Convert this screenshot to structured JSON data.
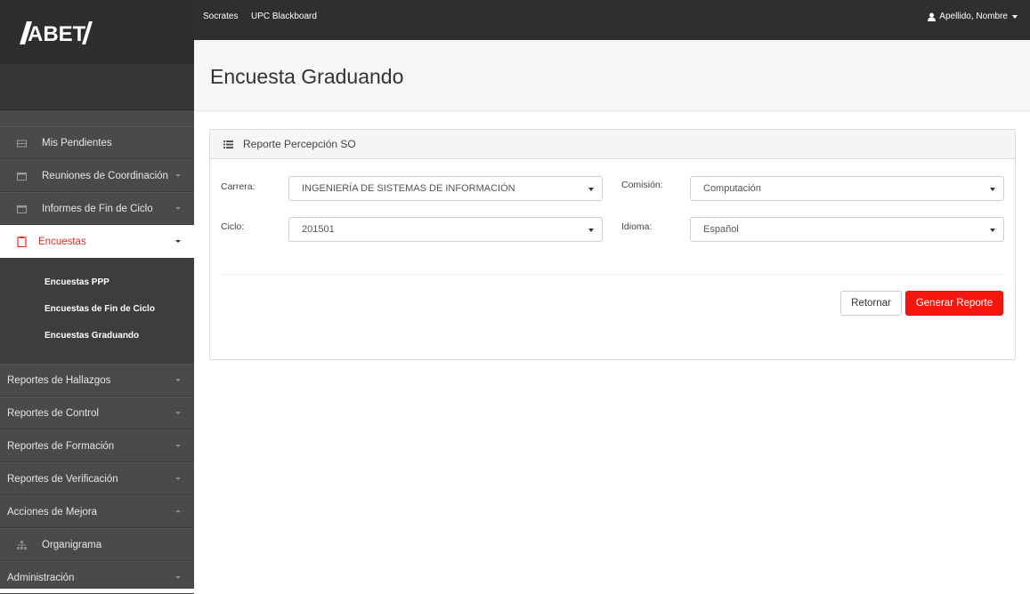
{
  "app": {
    "logo_text": "ABET"
  },
  "topbar": {
    "links": [
      "Socrates",
      "UPC Blackboard"
    ],
    "user_name": "Apellido, Nombre"
  },
  "sidebar": {
    "items": [
      {
        "label": "Mis Pendientes",
        "icon": "inbox-icon",
        "has_caret": false
      },
      {
        "label": "Reuniones de Coordinación",
        "icon": "calendar-icon",
        "has_caret": true
      },
      {
        "label": "Informes de Fin de Ciclo",
        "icon": "calendar-icon",
        "has_caret": true
      },
      {
        "label": "Encuestas",
        "icon": "clipboard-icon",
        "has_caret": true,
        "active": true
      }
    ],
    "subitems": [
      "Encuestas PPP",
      "Encuestas de Fin de Ciclo",
      "Encuestas Graduando"
    ],
    "items_after": [
      {
        "label": "Reportes de Hallazgos",
        "has_caret": true
      },
      {
        "label": "Reportes de Control",
        "has_caret": true
      },
      {
        "label": "Reportes de Formación",
        "has_caret": true
      },
      {
        "label": "Reportes de Verificación",
        "has_caret": true
      },
      {
        "label": "Acciones de Mejora",
        "has_caret": true
      },
      {
        "label": "Organigrama",
        "icon": "sitemap-icon",
        "has_caret": false
      },
      {
        "label": "Administración",
        "has_caret": true
      }
    ]
  },
  "page": {
    "title": "Encuesta Graduando"
  },
  "panel": {
    "title": "Reporte Percepción SO",
    "fields": {
      "carrera": {
        "label": "Carrera:",
        "value": "INGENIERÍA DE SISTEMAS DE INFORMACIÓN"
      },
      "comision": {
        "label": "Comisión:",
        "value": "Computación"
      },
      "ciclo": {
        "label": "Ciclo:",
        "value": "201501"
      },
      "idioma": {
        "label": "Idioma:",
        "value": "Español"
      }
    },
    "buttons": {
      "back": "Retornar",
      "generate": "Generar Reporte"
    }
  },
  "colors": {
    "accent": "#f5170f",
    "active_text": "#e52e20",
    "sidebar_bg": "#4a4a4a",
    "topbar_bg": "#2f2f2f"
  }
}
